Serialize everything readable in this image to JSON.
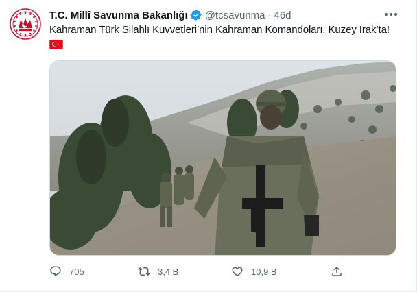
{
  "tweet": {
    "display_name": "T.C. Millî Savunma Bakanlığı",
    "handle": "@tcsavunma",
    "separator": "·",
    "time": "46d",
    "text": "Kahraman Türk Silahlı Kuvvetleri’nin Kahraman Komandoları, Kuzey Irak’ta!",
    "flag_emoji": "turkey-flag-icon"
  },
  "actions": {
    "reply_count": "705",
    "retweet_count": "3,4 B",
    "like_count": "10,9 B"
  },
  "colors": {
    "text": "#0f1419",
    "secondary": "#536471",
    "verified": "#1d9bf0",
    "brand_red": "#e30a17"
  }
}
